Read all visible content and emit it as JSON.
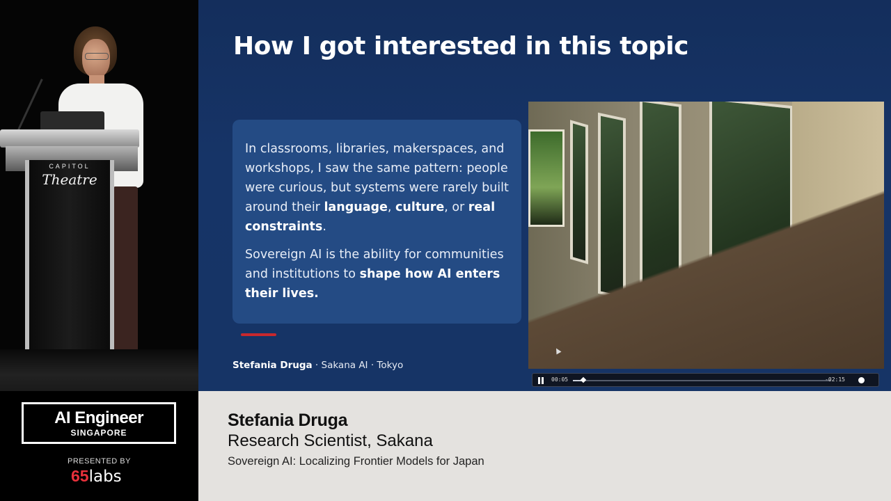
{
  "venue": {
    "line1": "CAPITOL",
    "line2": "Theatre"
  },
  "slide": {
    "title": "How I got interested in this topic",
    "callout": {
      "p1_a": "In classrooms, libraries, makerspaces, and workshops, I saw the same pattern: people were curious, but systems were rarely built around their ",
      "p1_b1": "language",
      "p1_c": ", ",
      "p1_b2": "culture",
      "p1_d": ", or ",
      "p1_b3": "real constraints",
      "p1_e": ".",
      "p2_a": "Sovereign AI is the ability for communities and institutions to ",
      "p2_b": "shape how AI enters their lives."
    },
    "byline": {
      "name": "Stefania Druga",
      "rest": " · Sakana AI · Tokyo"
    },
    "accent_color": "#c8282d"
  },
  "video": {
    "elapsed": "00:05",
    "remaining": "-02:15",
    "progress": 0.04
  },
  "event": {
    "logo_main": "AI Engineer",
    "logo_sub": "SINGAPORE",
    "presented_by": "PRESENTED BY",
    "sponsor_num": "65",
    "sponsor_word": "labs"
  },
  "speaker": {
    "name": "Stefania Druga",
    "role": "Research Scientist, Sakana",
    "talk": "Sovereign AI: Localizing Frontier Models for Japan"
  }
}
